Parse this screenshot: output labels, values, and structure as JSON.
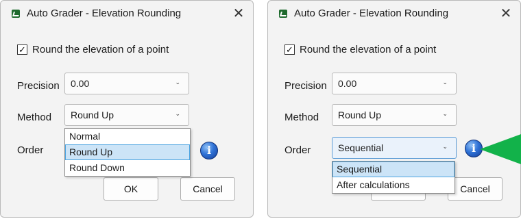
{
  "left": {
    "title": "Auto Grader - Elevation Rounding",
    "close_label": "✕",
    "checkbox_label": "Round the elevation of a point",
    "checkbox_mark": "✓",
    "precision_label": "Precision",
    "precision_value": "0.00",
    "method_label": "Method",
    "method_value": "Round Up",
    "order_label": "Order",
    "method_options": [
      "Normal",
      "Round Up",
      "Round Down"
    ],
    "ok_label": "OK",
    "cancel_label": "Cancel",
    "info_glyph": "i"
  },
  "right": {
    "title": "Auto Grader - Elevation Rounding",
    "close_label": "✕",
    "checkbox_label": "Round the elevation of a point",
    "checkbox_mark": "✓",
    "precision_label": "Precision",
    "precision_value": "0.00",
    "method_label": "Method",
    "method_value": "Round Up",
    "order_label": "Order",
    "order_value": "Sequential",
    "order_options": [
      "Sequential",
      "After calculations"
    ],
    "cancel_label": "Cancel",
    "info_glyph": "i"
  },
  "chevron": "⌄",
  "colors": {
    "accent": "#4ba3e0",
    "highlight": "#cce4f7",
    "arrow": "#12b24a",
    "info": "#2f72d6"
  }
}
